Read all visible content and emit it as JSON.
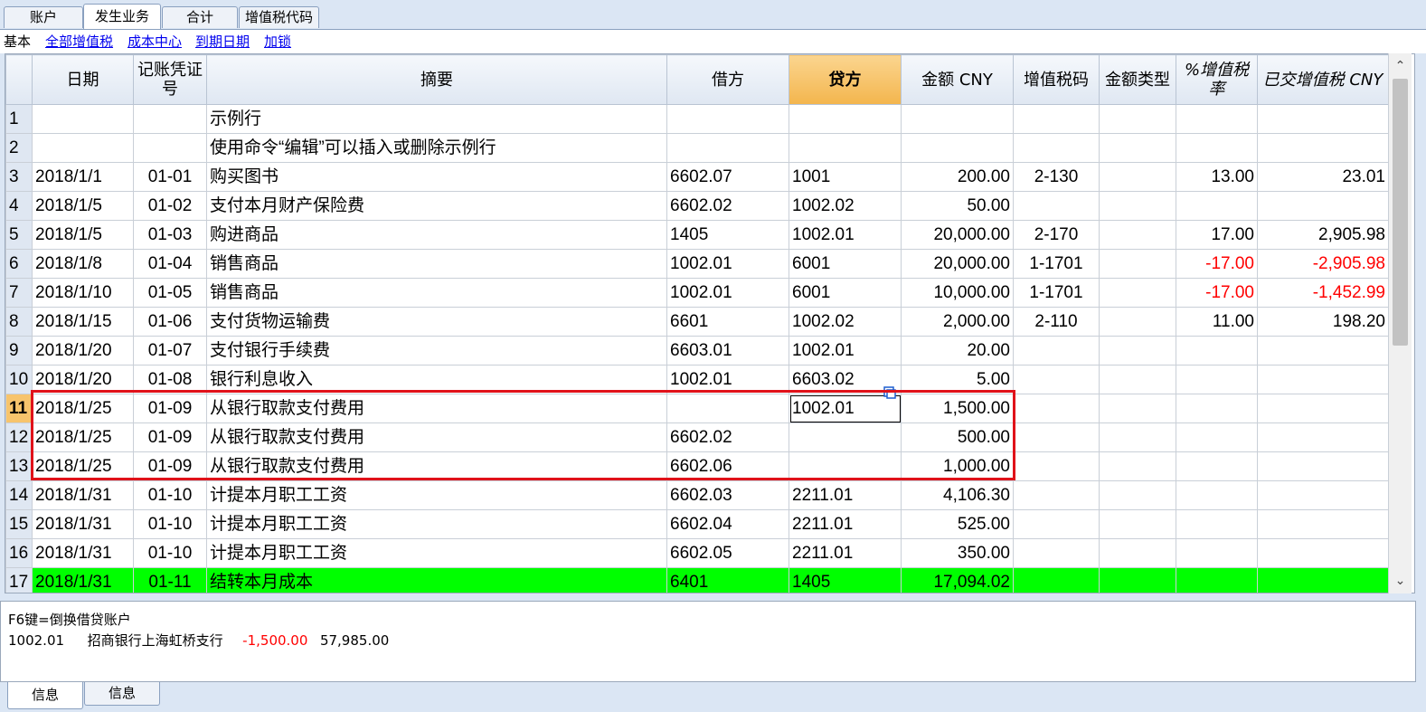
{
  "tabs_top": [
    "账户",
    "发生业务",
    "合计",
    "增值税代码"
  ],
  "view_bar": {
    "current": "基本",
    "links": [
      "全部增值税",
      "成本中心",
      "到期日期",
      "加锁"
    ]
  },
  "columns": {
    "date": "日期",
    "doc": "记账凭证号",
    "desc": "摘要",
    "debit": "借方",
    "credit": "贷方",
    "amount": "金额 CNY",
    "vatcode": "增值税码",
    "amttype": "金额类型",
    "vatpct": "%增值税率",
    "vatpaid": "已交增值税 CNY"
  },
  "rows": [
    {
      "n": "1",
      "date": "",
      "doc": "",
      "desc": "示例行",
      "debit": "",
      "credit": "",
      "amount": "",
      "vatcode": "",
      "amttype": "",
      "vatpct": "",
      "vatpaid": ""
    },
    {
      "n": "2",
      "date": "",
      "doc": "",
      "desc": "使用命令“编辑”可以插入或删除示例行",
      "debit": "",
      "credit": "",
      "amount": "",
      "vatcode": "",
      "amttype": "",
      "vatpct": "",
      "vatpaid": ""
    },
    {
      "n": "3",
      "date": "2018/1/1",
      "doc": "01-01",
      "desc": "购买图书",
      "debit": "6602.07",
      "credit": "1001",
      "amount": "200.00",
      "vatcode": "2-130",
      "amttype": "",
      "vatpct": "13.00",
      "vatpaid": "23.01"
    },
    {
      "n": "4",
      "date": "2018/1/5",
      "doc": "01-02",
      "desc": "支付本月财产保险费",
      "debit": "6602.02",
      "credit": "1002.02",
      "amount": "50.00",
      "vatcode": "",
      "amttype": "",
      "vatpct": "",
      "vatpaid": ""
    },
    {
      "n": "5",
      "date": "2018/1/5",
      "doc": "01-03",
      "desc": "购进商品",
      "debit": "1405",
      "credit": "1002.01",
      "amount": "20,000.00",
      "vatcode": "2-170",
      "amttype": "",
      "vatpct": "17.00",
      "vatpaid": "2,905.98"
    },
    {
      "n": "6",
      "date": "2018/1/8",
      "doc": "01-04",
      "desc": "销售商品",
      "debit": "1002.01",
      "credit": "6001",
      "amount": "20,000.00",
      "vatcode": "1-1701",
      "amttype": "",
      "vatpct": "-17.00",
      "vatpaid": "-2,905.98"
    },
    {
      "n": "7",
      "date": "2018/1/10",
      "doc": "01-05",
      "desc": "销售商品",
      "debit": "1002.01",
      "credit": "6001",
      "amount": "10,000.00",
      "vatcode": "1-1701",
      "amttype": "",
      "vatpct": "-17.00",
      "vatpaid": "-1,452.99"
    },
    {
      "n": "8",
      "date": "2018/1/15",
      "doc": "01-06",
      "desc": "支付货物运输费",
      "debit": "6601",
      "credit": "1002.02",
      "amount": "2,000.00",
      "vatcode": "2-110",
      "amttype": "",
      "vatpct": "11.00",
      "vatpaid": "198.20"
    },
    {
      "n": "9",
      "date": "2018/1/20",
      "doc": "01-07",
      "desc": "支付银行手续费",
      "debit": "6603.01",
      "credit": "1002.01",
      "amount": "20.00",
      "vatcode": "",
      "amttype": "",
      "vatpct": "",
      "vatpaid": ""
    },
    {
      "n": "10",
      "date": "2018/1/20",
      "doc": "01-08",
      "desc": "银行利息收入",
      "debit": "1002.01",
      "credit": "6603.02",
      "amount": "5.00",
      "vatcode": "",
      "amttype": "",
      "vatpct": "",
      "vatpaid": ""
    },
    {
      "n": "11",
      "date": "2018/1/25",
      "doc": "01-09",
      "desc": "从银行取款支付费用",
      "debit": "",
      "credit": "1002.01",
      "amount": "1,500.00",
      "vatcode": "",
      "amttype": "",
      "vatpct": "",
      "vatpaid": ""
    },
    {
      "n": "12",
      "date": "2018/1/25",
      "doc": "01-09",
      "desc": "从银行取款支付费用",
      "debit": "6602.02",
      "credit": "",
      "amount": "500.00",
      "vatcode": "",
      "amttype": "",
      "vatpct": "",
      "vatpaid": ""
    },
    {
      "n": "13",
      "date": "2018/1/25",
      "doc": "01-09",
      "desc": "从银行取款支付费用",
      "debit": "6602.06",
      "credit": "",
      "amount": "1,000.00",
      "vatcode": "",
      "amttype": "",
      "vatpct": "",
      "vatpaid": ""
    },
    {
      "n": "14",
      "date": "2018/1/31",
      "doc": "01-10",
      "desc": "计提本月职工工资",
      "debit": "6602.03",
      "credit": "2211.01",
      "amount": "4,106.30",
      "vatcode": "",
      "amttype": "",
      "vatpct": "",
      "vatpaid": ""
    },
    {
      "n": "15",
      "date": "2018/1/31",
      "doc": "01-10",
      "desc": "计提本月职工工资",
      "debit": "6602.04",
      "credit": "2211.01",
      "amount": "525.00",
      "vatcode": "",
      "amttype": "",
      "vatpct": "",
      "vatpaid": ""
    },
    {
      "n": "16",
      "date": "2018/1/31",
      "doc": "01-10",
      "desc": "计提本月职工工资",
      "debit": "6602.05",
      "credit": "2211.01",
      "amount": "350.00",
      "vatcode": "",
      "amttype": "",
      "vatpct": "",
      "vatpaid": ""
    },
    {
      "n": "17",
      "date": "2018/1/31",
      "doc": "01-11",
      "desc": "结转本月成本",
      "debit": "6401",
      "credit": "1405",
      "amount": "17,094.02",
      "vatcode": "",
      "amttype": "",
      "vatpct": "",
      "vatpaid": ""
    }
  ],
  "info": {
    "hint": "F6键=倒换借贷账户",
    "account": "1002.01",
    "account_name": "招商银行上海虹桥支行",
    "change": "-1,500.00",
    "balance": "57,985.00"
  },
  "tabs_bottom": [
    "信息",
    "信息"
  ],
  "colors": {
    "highlight_row": "#00ff00",
    "negative": "#ff0000",
    "annotation_box": "#e0121a",
    "active_header": "#f3b54d"
  }
}
